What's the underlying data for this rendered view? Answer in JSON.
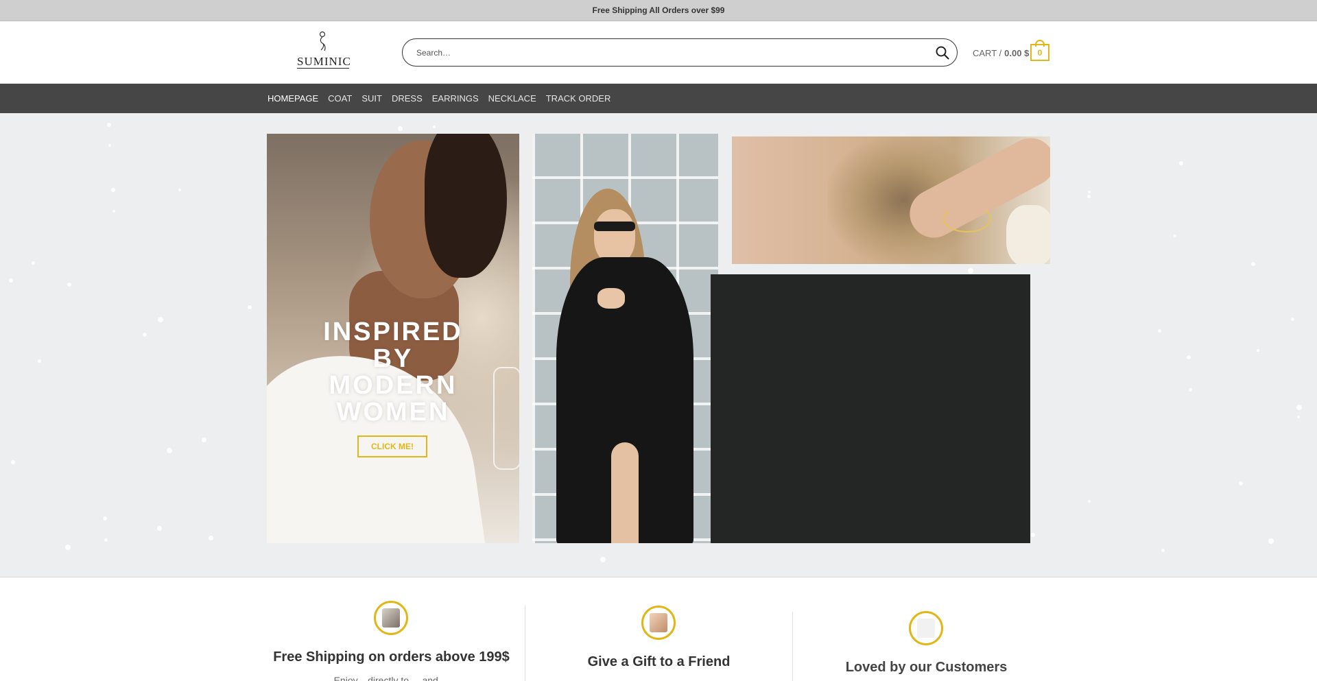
{
  "topbar": {
    "text": "Free Shipping All Orders over $99"
  },
  "header": {
    "logo_text": "SUMINIC",
    "search": {
      "placeholder": "Search…"
    },
    "cart": {
      "label": "CART /",
      "amount": "0.00 $",
      "count": "0"
    }
  },
  "nav": {
    "items": [
      {
        "label": "HOMEPAGE",
        "active": true
      },
      {
        "label": "COAT"
      },
      {
        "label": "SUIT"
      },
      {
        "label": "DRESS"
      },
      {
        "label": "EARRINGS"
      },
      {
        "label": "NECKLACE"
      },
      {
        "label": "TRACK ORDER"
      }
    ]
  },
  "hero": {
    "headline_lines": [
      "INSPIRED",
      "BY",
      "MODERN",
      "WOMEN"
    ],
    "button_label": "CLICK ME!"
  },
  "features": [
    {
      "title": "Free Shipping on orders above 199$",
      "text": "Enjoy... directly to ... and ..."
    },
    {
      "title": "Give a Gift to a Friend"
    },
    {
      "title": "Loved by our Customers"
    }
  ],
  "colors": {
    "accent": "#e2b616",
    "nav_bg": "#464646",
    "topbar_bg": "#cfcfcf",
    "hero_bg": "#eceef0"
  },
  "icons": [
    "search-icon",
    "cart-icon",
    "logo-figure-icon"
  ]
}
